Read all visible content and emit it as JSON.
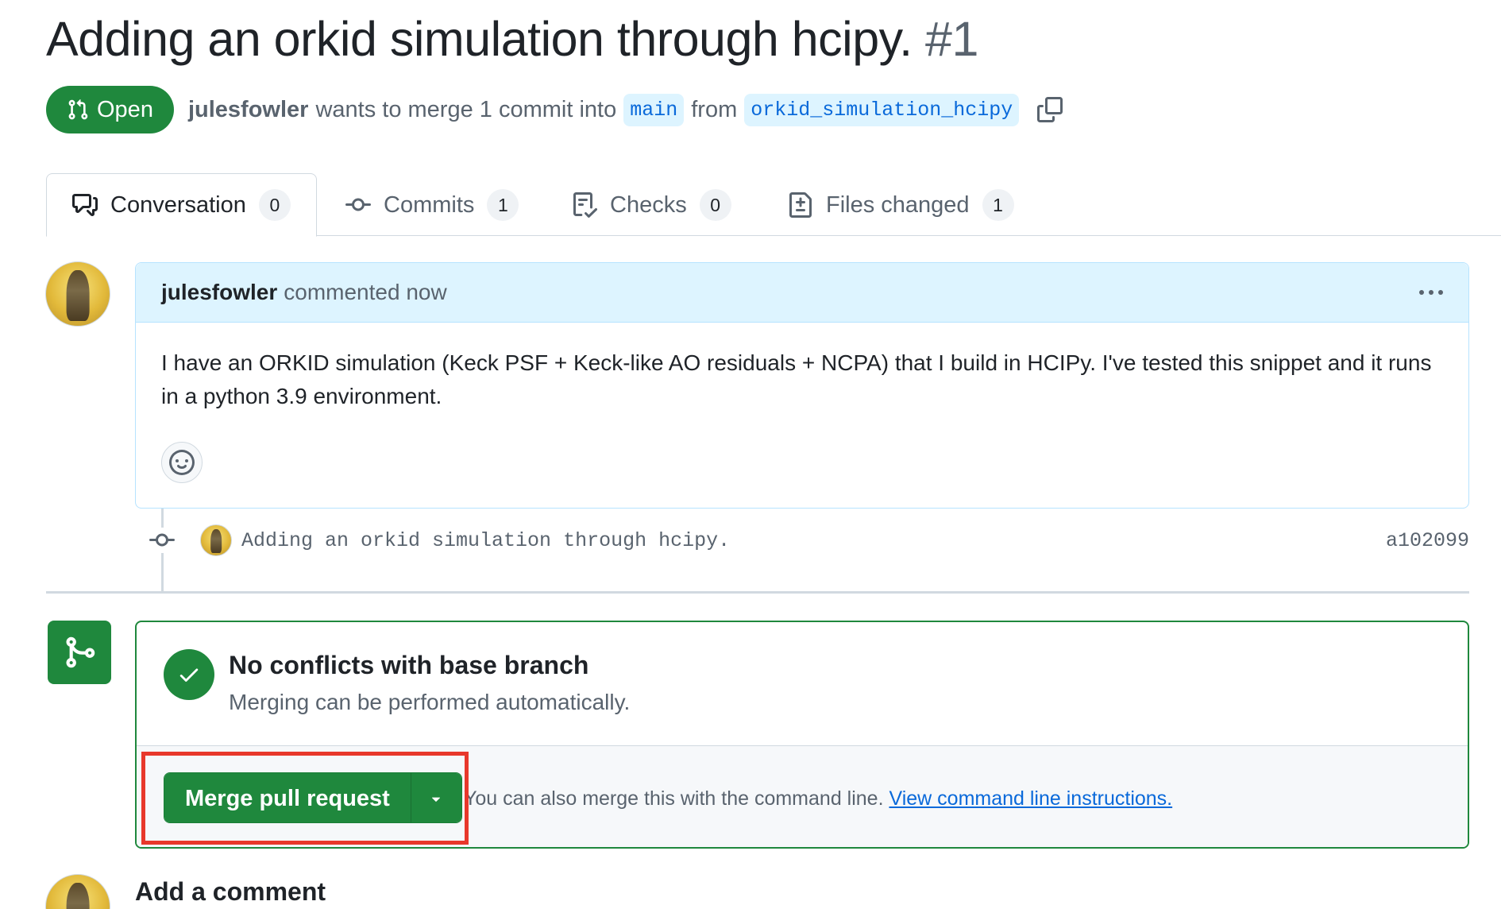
{
  "pr": {
    "title": "Adding an orkid simulation through hcipy.",
    "number": "#1",
    "state": "Open",
    "author": "julesfowler",
    "merge_text_1": "wants to merge 1 commit into",
    "base_branch": "main",
    "merge_text_2": "from",
    "head_branch": "orkid_simulation_hcipy"
  },
  "tabs": [
    {
      "label": "Conversation",
      "count": "0",
      "icon": "comment-discussion-icon"
    },
    {
      "label": "Commits",
      "count": "1",
      "icon": "git-commit-icon"
    },
    {
      "label": "Checks",
      "count": "0",
      "icon": "checklist-icon"
    },
    {
      "label": "Files changed",
      "count": "1",
      "icon": "file-diff-icon"
    }
  ],
  "comment": {
    "author": "julesfowler",
    "action": "commented now",
    "body": "I have an ORKID simulation (Keck PSF + Keck-like AO residuals + NCPA) that I build in HCIPy. I've tested this snippet and it runs in a python 3.9 environment."
  },
  "commit": {
    "message": "Adding an orkid simulation through hcipy.",
    "sha": "a102099"
  },
  "merge": {
    "title": "No conflicts with base branch",
    "subtitle": "Merging can be performed automatically.",
    "button_label": "Merge pull request",
    "hint_prefix": "You can also merge this with the command line.",
    "hint_link": "View command line instructions."
  },
  "add_comment": {
    "title": "Add a comment"
  },
  "colors": {
    "open_green": "#1f883d",
    "link_blue": "#0969da",
    "branch_bg": "#ddf4ff",
    "highlight_red": "#e8382b"
  }
}
